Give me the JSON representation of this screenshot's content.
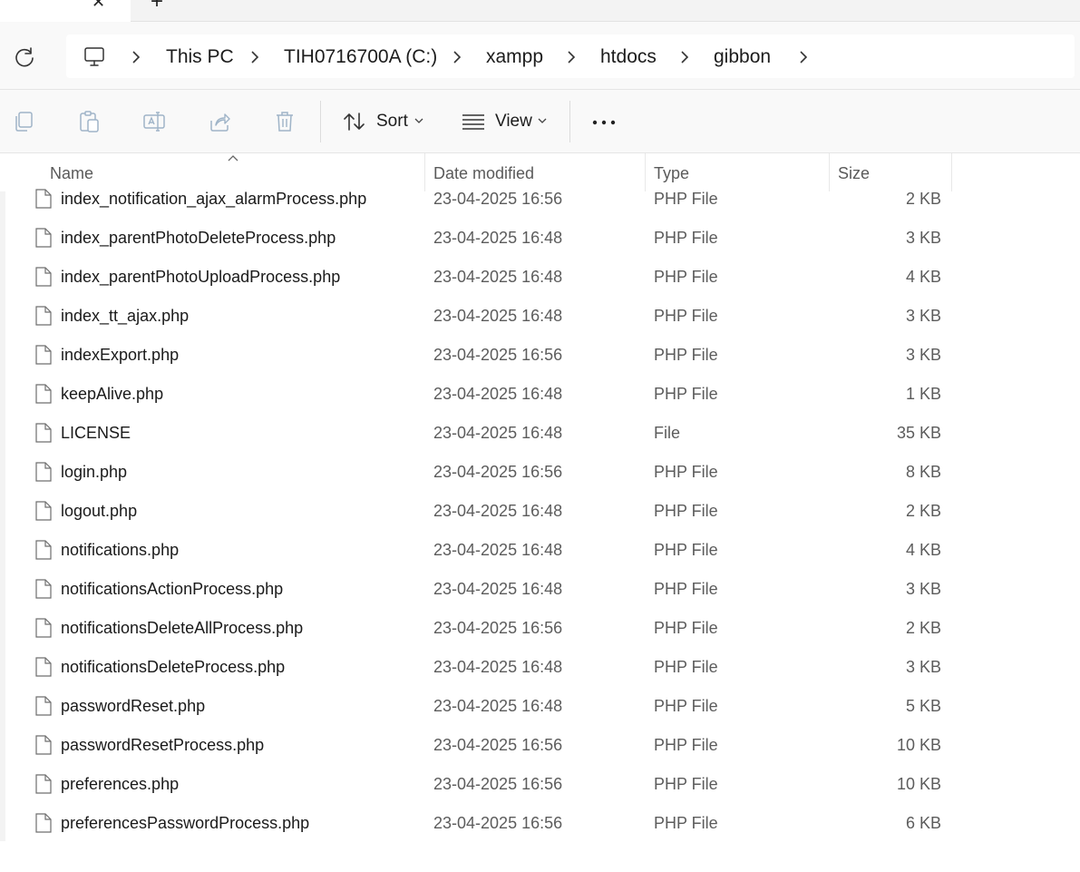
{
  "tabs": {
    "close_glyph": "✕",
    "new_glyph": "+"
  },
  "breadcrumb": [
    "This PC",
    "TIH0716700A (C:)",
    "xampp",
    "htdocs",
    "gibbon"
  ],
  "toolbar": {
    "sort_label": "Sort",
    "view_label": "View",
    "more_label": "•••"
  },
  "columns": {
    "name": "Name",
    "date": "Date modified",
    "type": "Type",
    "size": "Size"
  },
  "files": [
    {
      "name": "index_notification_ajax_alarmProcess.php",
      "date": "23-04-2025 16:56",
      "type": "PHP File",
      "size": "2 KB"
    },
    {
      "name": "index_parentPhotoDeleteProcess.php",
      "date": "23-04-2025 16:48",
      "type": "PHP File",
      "size": "3 KB"
    },
    {
      "name": "index_parentPhotoUploadProcess.php",
      "date": "23-04-2025 16:48",
      "type": "PHP File",
      "size": "4 KB"
    },
    {
      "name": "index_tt_ajax.php",
      "date": "23-04-2025 16:48",
      "type": "PHP File",
      "size": "3 KB"
    },
    {
      "name": "indexExport.php",
      "date": "23-04-2025 16:56",
      "type": "PHP File",
      "size": "3 KB"
    },
    {
      "name": "keepAlive.php",
      "date": "23-04-2025 16:48",
      "type": "PHP File",
      "size": "1 KB"
    },
    {
      "name": "LICENSE",
      "date": "23-04-2025 16:48",
      "type": "File",
      "size": "35 KB"
    },
    {
      "name": "login.php",
      "date": "23-04-2025 16:56",
      "type": "PHP File",
      "size": "8 KB"
    },
    {
      "name": "logout.php",
      "date": "23-04-2025 16:48",
      "type": "PHP File",
      "size": "2 KB"
    },
    {
      "name": "notifications.php",
      "date": "23-04-2025 16:48",
      "type": "PHP File",
      "size": "4 KB"
    },
    {
      "name": "notificationsActionProcess.php",
      "date": "23-04-2025 16:48",
      "type": "PHP File",
      "size": "3 KB"
    },
    {
      "name": "notificationsDeleteAllProcess.php",
      "date": "23-04-2025 16:56",
      "type": "PHP File",
      "size": "2 KB"
    },
    {
      "name": "notificationsDeleteProcess.php",
      "date": "23-04-2025 16:48",
      "type": "PHP File",
      "size": "3 KB"
    },
    {
      "name": "passwordReset.php",
      "date": "23-04-2025 16:48",
      "type": "PHP File",
      "size": "5 KB"
    },
    {
      "name": "passwordResetProcess.php",
      "date": "23-04-2025 16:56",
      "type": "PHP File",
      "size": "10 KB"
    },
    {
      "name": "preferences.php",
      "date": "23-04-2025 16:56",
      "type": "PHP File",
      "size": "10 KB"
    },
    {
      "name": "preferencesPasswordProcess.php",
      "date": "23-04-2025 16:56",
      "type": "PHP File",
      "size": "6 KB"
    }
  ]
}
